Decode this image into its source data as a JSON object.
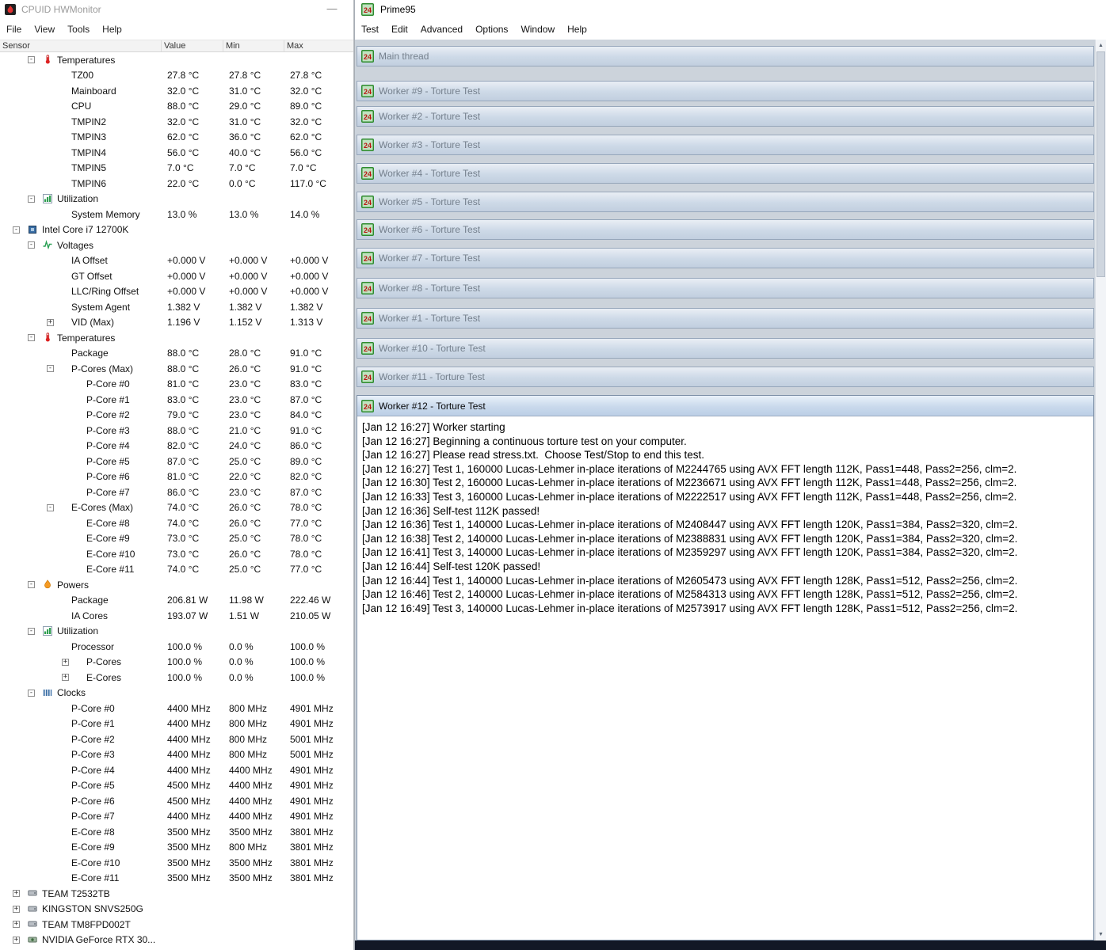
{
  "hwmonitor": {
    "title": "CPUID HWMonitor",
    "window_buttons": {
      "minimize": "—"
    },
    "menu": [
      "File",
      "View",
      "Tools",
      "Help"
    ],
    "columns": [
      "Sensor",
      "Value",
      "Min",
      "Max"
    ],
    "rows": [
      {
        "label": "Temperatures",
        "value": "",
        "min": "",
        "max": "",
        "indent": 2,
        "icon": "temperature",
        "exp": "-"
      },
      {
        "label": "TZ00",
        "value": "27.8 °C",
        "min": "27.8 °C",
        "max": "27.8 °C",
        "indent": 4
      },
      {
        "label": "Mainboard",
        "value": "32.0 °C",
        "min": "31.0 °C",
        "max": "32.0 °C",
        "indent": 4
      },
      {
        "label": "CPU",
        "value": "88.0 °C",
        "min": "29.0 °C",
        "max": "89.0 °C",
        "indent": 4
      },
      {
        "label": "TMPIN2",
        "value": "32.0 °C",
        "min": "31.0 °C",
        "max": "32.0 °C",
        "indent": 4
      },
      {
        "label": "TMPIN3",
        "value": "62.0 °C",
        "min": "36.0 °C",
        "max": "62.0 °C",
        "indent": 4
      },
      {
        "label": "TMPIN4",
        "value": "56.0 °C",
        "min": "40.0 °C",
        "max": "56.0 °C",
        "indent": 4
      },
      {
        "label": "TMPIN5",
        "value": "7.0 °C",
        "min": "7.0 °C",
        "max": "7.0 °C",
        "indent": 4
      },
      {
        "label": "TMPIN6",
        "value": "22.0 °C",
        "min": "0.0 °C",
        "max": "117.0 °C",
        "indent": 4
      },
      {
        "label": "Utilization",
        "value": "",
        "min": "",
        "max": "",
        "indent": 2,
        "icon": "utilization",
        "exp": "-"
      },
      {
        "label": "System Memory",
        "value": "13.0 %",
        "min": "13.0 %",
        "max": "14.0 %",
        "indent": 4
      },
      {
        "label": "Intel Core i7 12700K",
        "value": "",
        "min": "",
        "max": "",
        "indent": 1,
        "icon": "cpu",
        "exp": "-"
      },
      {
        "label": "Voltages",
        "value": "",
        "min": "",
        "max": "",
        "indent": 2,
        "icon": "voltage",
        "exp": "-"
      },
      {
        "label": "IA Offset",
        "value": "+0.000 V",
        "min": "+0.000 V",
        "max": "+0.000 V",
        "indent": 4
      },
      {
        "label": "GT Offset",
        "value": "+0.000 V",
        "min": "+0.000 V",
        "max": "+0.000 V",
        "indent": 4
      },
      {
        "label": "LLC/Ring Offset",
        "value": "+0.000 V",
        "min": "+0.000 V",
        "max": "+0.000 V",
        "indent": 4
      },
      {
        "label": "System Agent",
        "value": "1.382 V",
        "min": "1.382 V",
        "max": "1.382 V",
        "indent": 4
      },
      {
        "label": "VID (Max)",
        "value": "1.196 V",
        "min": "1.152 V",
        "max": "1.313 V",
        "indent": 4,
        "exp": "+"
      },
      {
        "label": "Temperatures",
        "value": "",
        "min": "",
        "max": "",
        "indent": 2,
        "icon": "temperature",
        "exp": "-"
      },
      {
        "label": "Package",
        "value": "88.0 °C",
        "min": "28.0 °C",
        "max": "91.0 °C",
        "indent": 4
      },
      {
        "label": "P-Cores (Max)",
        "value": "88.0 °C",
        "min": "26.0 °C",
        "max": "91.0 °C",
        "indent": 4,
        "exp": "-"
      },
      {
        "label": "P-Core #0",
        "value": "81.0 °C",
        "min": "23.0 °C",
        "max": "83.0 °C",
        "indent": 5
      },
      {
        "label": "P-Core #1",
        "value": "83.0 °C",
        "min": "23.0 °C",
        "max": "87.0 °C",
        "indent": 5
      },
      {
        "label": "P-Core #2",
        "value": "79.0 °C",
        "min": "23.0 °C",
        "max": "84.0 °C",
        "indent": 5
      },
      {
        "label": "P-Core #3",
        "value": "88.0 °C",
        "min": "21.0 °C",
        "max": "91.0 °C",
        "indent": 5
      },
      {
        "label": "P-Core #4",
        "value": "82.0 °C",
        "min": "24.0 °C",
        "max": "86.0 °C",
        "indent": 5
      },
      {
        "label": "P-Core #5",
        "value": "87.0 °C",
        "min": "25.0 °C",
        "max": "89.0 °C",
        "indent": 5
      },
      {
        "label": "P-Core #6",
        "value": "81.0 °C",
        "min": "22.0 °C",
        "max": "82.0 °C",
        "indent": 5
      },
      {
        "label": "P-Core #7",
        "value": "86.0 °C",
        "min": "23.0 °C",
        "max": "87.0 °C",
        "indent": 5
      },
      {
        "label": "E-Cores (Max)",
        "value": "74.0 °C",
        "min": "26.0 °C",
        "max": "78.0 °C",
        "indent": 4,
        "exp": "-"
      },
      {
        "label": "E-Core #8",
        "value": "74.0 °C",
        "min": "26.0 °C",
        "max": "77.0 °C",
        "indent": 5
      },
      {
        "label": "E-Core #9",
        "value": "73.0 °C",
        "min": "25.0 °C",
        "max": "78.0 °C",
        "indent": 5
      },
      {
        "label": "E-Core #10",
        "value": "73.0 °C",
        "min": "26.0 °C",
        "max": "78.0 °C",
        "indent": 5
      },
      {
        "label": "E-Core #11",
        "value": "74.0 °C",
        "min": "25.0 °C",
        "max": "77.0 °C",
        "indent": 5
      },
      {
        "label": "Powers",
        "value": "",
        "min": "",
        "max": "",
        "indent": 2,
        "icon": "power",
        "exp": "-"
      },
      {
        "label": "Package",
        "value": "206.81 W",
        "min": "11.98 W",
        "max": "222.46 W",
        "indent": 4
      },
      {
        "label": "IA Cores",
        "value": "193.07 W",
        "min": "1.51 W",
        "max": "210.05 W",
        "indent": 4
      },
      {
        "label": "Utilization",
        "value": "",
        "min": "",
        "max": "",
        "indent": 2,
        "icon": "utilization",
        "exp": "-"
      },
      {
        "label": "Processor",
        "value": "100.0 %",
        "min": "0.0 %",
        "max": "100.0 %",
        "indent": 4
      },
      {
        "label": "P-Cores",
        "value": "100.0 %",
        "min": "0.0 %",
        "max": "100.0 %",
        "indent": 5,
        "exp": "+"
      },
      {
        "label": "E-Cores",
        "value": "100.0 %",
        "min": "0.0 %",
        "max": "100.0 %",
        "indent": 5,
        "exp": "+"
      },
      {
        "label": "Clocks",
        "value": "",
        "min": "",
        "max": "",
        "indent": 2,
        "icon": "clock",
        "exp": "-"
      },
      {
        "label": "P-Core #0",
        "value": "4400 MHz",
        "min": "800 MHz",
        "max": "4901 MHz",
        "indent": 4
      },
      {
        "label": "P-Core #1",
        "value": "4400 MHz",
        "min": "800 MHz",
        "max": "4901 MHz",
        "indent": 4
      },
      {
        "label": "P-Core #2",
        "value": "4400 MHz",
        "min": "800 MHz",
        "max": "5001 MHz",
        "indent": 4
      },
      {
        "label": "P-Core #3",
        "value": "4400 MHz",
        "min": "800 MHz",
        "max": "5001 MHz",
        "indent": 4
      },
      {
        "label": "P-Core #4",
        "value": "4400 MHz",
        "min": "4400 MHz",
        "max": "4901 MHz",
        "indent": 4
      },
      {
        "label": "P-Core #5",
        "value": "4500 MHz",
        "min": "4400 MHz",
        "max": "4901 MHz",
        "indent": 4
      },
      {
        "label": "P-Core #6",
        "value": "4500 MHz",
        "min": "4400 MHz",
        "max": "4901 MHz",
        "indent": 4
      },
      {
        "label": "P-Core #7",
        "value": "4400 MHz",
        "min": "4400 MHz",
        "max": "4901 MHz",
        "indent": 4
      },
      {
        "label": "E-Core #8",
        "value": "3500 MHz",
        "min": "3500 MHz",
        "max": "3801 MHz",
        "indent": 4
      },
      {
        "label": "E-Core #9",
        "value": "3500 MHz",
        "min": "800 MHz",
        "max": "3801 MHz",
        "indent": 4
      },
      {
        "label": "E-Core #10",
        "value": "3500 MHz",
        "min": "3500 MHz",
        "max": "3801 MHz",
        "indent": 4
      },
      {
        "label": "E-Core #11",
        "value": "3500 MHz",
        "min": "3500 MHz",
        "max": "3801 MHz",
        "indent": 4
      },
      {
        "label": "TEAM T2532TB",
        "value": "",
        "min": "",
        "max": "",
        "indent": 1,
        "icon": "disk",
        "exp": "+"
      },
      {
        "label": "KINGSTON SNVS250G",
        "value": "",
        "min": "",
        "max": "",
        "indent": 1,
        "icon": "disk",
        "exp": "+"
      },
      {
        "label": "TEAM TM8FPD002T",
        "value": "",
        "min": "",
        "max": "",
        "indent": 1,
        "icon": "disk",
        "exp": "+"
      },
      {
        "label": "NVIDIA GeForce RTX 30...",
        "value": "",
        "min": "",
        "max": "",
        "indent": 1,
        "icon": "gpu",
        "exp": "+"
      }
    ]
  },
  "prime95": {
    "title": "Prime95",
    "menu": [
      "Test",
      "Edit",
      "Advanced",
      "Options",
      "Window",
      "Help"
    ],
    "child_windows": [
      "Main thread",
      "Worker #9 - Torture Test",
      "Worker #2 - Torture Test",
      "Worker #3 - Torture Test",
      "Worker #4 - Torture Test",
      "Worker #5 - Torture Test",
      "Worker #6 - Torture Test",
      "Worker #7 - Torture Test",
      "Worker #8 - Torture Test",
      "Worker #1 - Torture Test",
      "Worker #10 - Torture Test",
      "Worker #11 - Torture Test"
    ],
    "active_window": {
      "title": "Worker #12 - Torture Test",
      "log": [
        "[Jan 12 16:27] Worker starting",
        "[Jan 12 16:27] Beginning a continuous torture test on your computer.",
        "[Jan 12 16:27] Please read stress.txt.  Choose Test/Stop to end this test.",
        "[Jan 12 16:27] Test 1, 160000 Lucas-Lehmer in-place iterations of M2244765 using AVX FFT length 112K, Pass1=448, Pass2=256, clm=2.",
        "[Jan 12 16:30] Test 2, 160000 Lucas-Lehmer in-place iterations of M2236671 using AVX FFT length 112K, Pass1=448, Pass2=256, clm=2.",
        "[Jan 12 16:33] Test 3, 160000 Lucas-Lehmer in-place iterations of M2222517 using AVX FFT length 112K, Pass1=448, Pass2=256, clm=2.",
        "[Jan 12 16:36] Self-test 112K passed!",
        "[Jan 12 16:36] Test 1, 140000 Lucas-Lehmer in-place iterations of M2408447 using AVX FFT length 120K, Pass1=384, Pass2=320, clm=2.",
        "[Jan 12 16:38] Test 2, 140000 Lucas-Lehmer in-place iterations of M2388831 using AVX FFT length 120K, Pass1=384, Pass2=320, clm=2.",
        "[Jan 12 16:41] Test 3, 140000 Lucas-Lehmer in-place iterations of M2359297 using AVX FFT length 120K, Pass1=384, Pass2=320, clm=2.",
        "[Jan 12 16:44] Self-test 120K passed!",
        "[Jan 12 16:44] Test 1, 140000 Lucas-Lehmer in-place iterations of M2605473 using AVX FFT length 128K, Pass1=512, Pass2=256, clm=2.",
        "[Jan 12 16:46] Test 2, 140000 Lucas-Lehmer in-place iterations of M2584313 using AVX FFT length 128K, Pass1=512, Pass2=256, clm=2.",
        "[Jan 12 16:49] Test 3, 140000 Lucas-Lehmer in-place iterations of M2573917 using AVX FFT length 128K, Pass1=512, Pass2=256, clm=2."
      ]
    }
  },
  "icons": {
    "hwmonitor_app": "flame-icon",
    "prime95_app": "prime95-24-icon",
    "temperature": "thermometer-icon",
    "utilization": "bar-chart-icon",
    "cpu": "chip-icon",
    "voltage": "waveform-icon",
    "power": "flame-icon",
    "clock": "frequency-bars-icon",
    "disk": "drive-icon",
    "gpu": "gpu-icon"
  },
  "colors": {
    "inactive_caption_text": "#75808d",
    "active_caption_text": "#0a0a0a",
    "mdi_background": "#ccd3db",
    "taskbar": "#121826",
    "hw_title_text": "#9a9a9a"
  }
}
